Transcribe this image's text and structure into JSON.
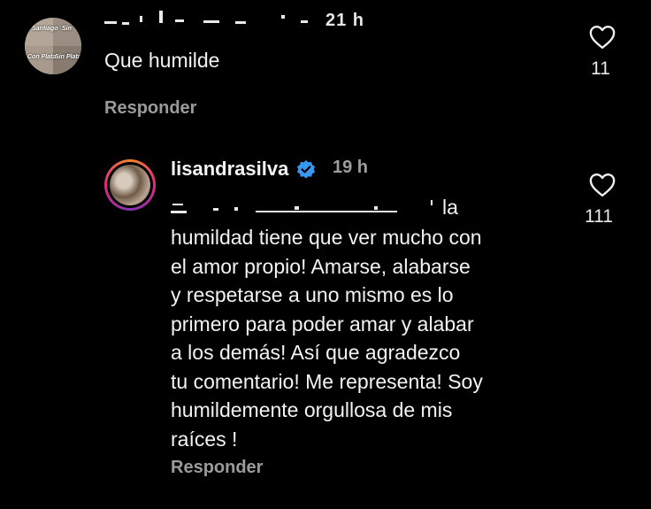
{
  "comment": {
    "time": "21 h",
    "text": "Que humilde",
    "reply_label": "Responder",
    "like_count": "11",
    "avatar_text": [
      "Santiago",
      "Sin",
      "Con Plata",
      "Sin Plata"
    ]
  },
  "reply": {
    "username": "lisandrasilva",
    "time": "19 h",
    "first_word": "la",
    "text": "humildad tiene que ver mucho con\nel amor propio! Amarse, alabarse\ny respetarse a uno mismo es lo\nprimero para poder amar y alabar\na los demás! Así que agradezco\ntu comentario! Me representa! Soy\nhumildemente orgullosa de mis\nraíces !",
    "reply_label": "Responder",
    "like_count": "111"
  },
  "icons": {
    "like": "heart-outline-icon",
    "verified": "verified-badge-icon"
  },
  "colors": {
    "background": "#000000",
    "text": "#f3f3f3",
    "muted": "#9b9b9b",
    "verified": "#3897f0"
  }
}
